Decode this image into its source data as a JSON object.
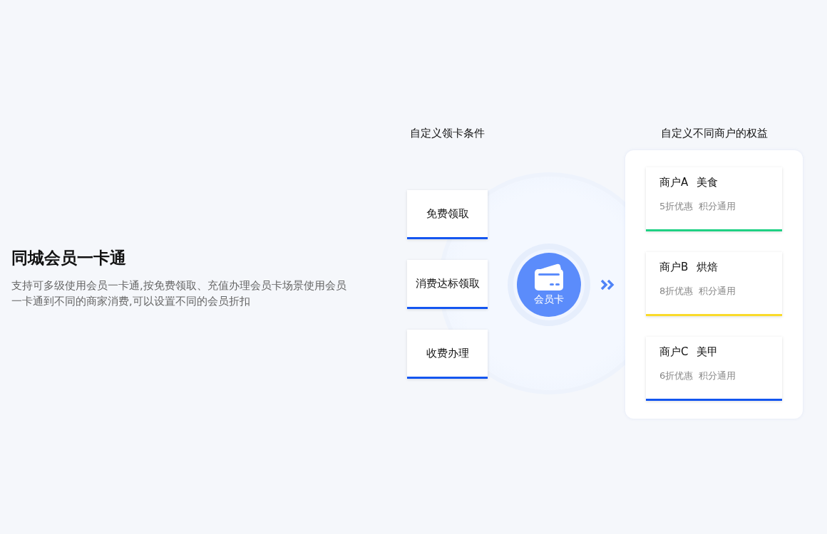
{
  "intro": {
    "title": "同城会员一卡通",
    "description": "支持可多级使用会员一卡通,按免费领取、充值办理会员卡场景使用会员一卡通到不同的商家消费,可以设置不同的会员折扣"
  },
  "conditions": {
    "heading": "自定义领卡条件",
    "items": [
      {
        "label": "免费领取"
      },
      {
        "label": "消费达标领取"
      },
      {
        "label": "收费办理"
      }
    ]
  },
  "card": {
    "label": "会员卡"
  },
  "merchants": {
    "heading": "自定义不同商户的权益",
    "items": [
      {
        "name": "商户A",
        "category": "美食",
        "discount": "5折优惠",
        "points": "积分通用",
        "color": "#1fd184"
      },
      {
        "name": "商户B",
        "category": "烘焙",
        "discount": "8折优惠",
        "points": "积分通用",
        "color": "#fadb2a"
      },
      {
        "name": "商户C",
        "category": "美甲",
        "discount": "6折优惠",
        "points": "积分通用",
        "color": "#1456f0"
      }
    ]
  }
}
